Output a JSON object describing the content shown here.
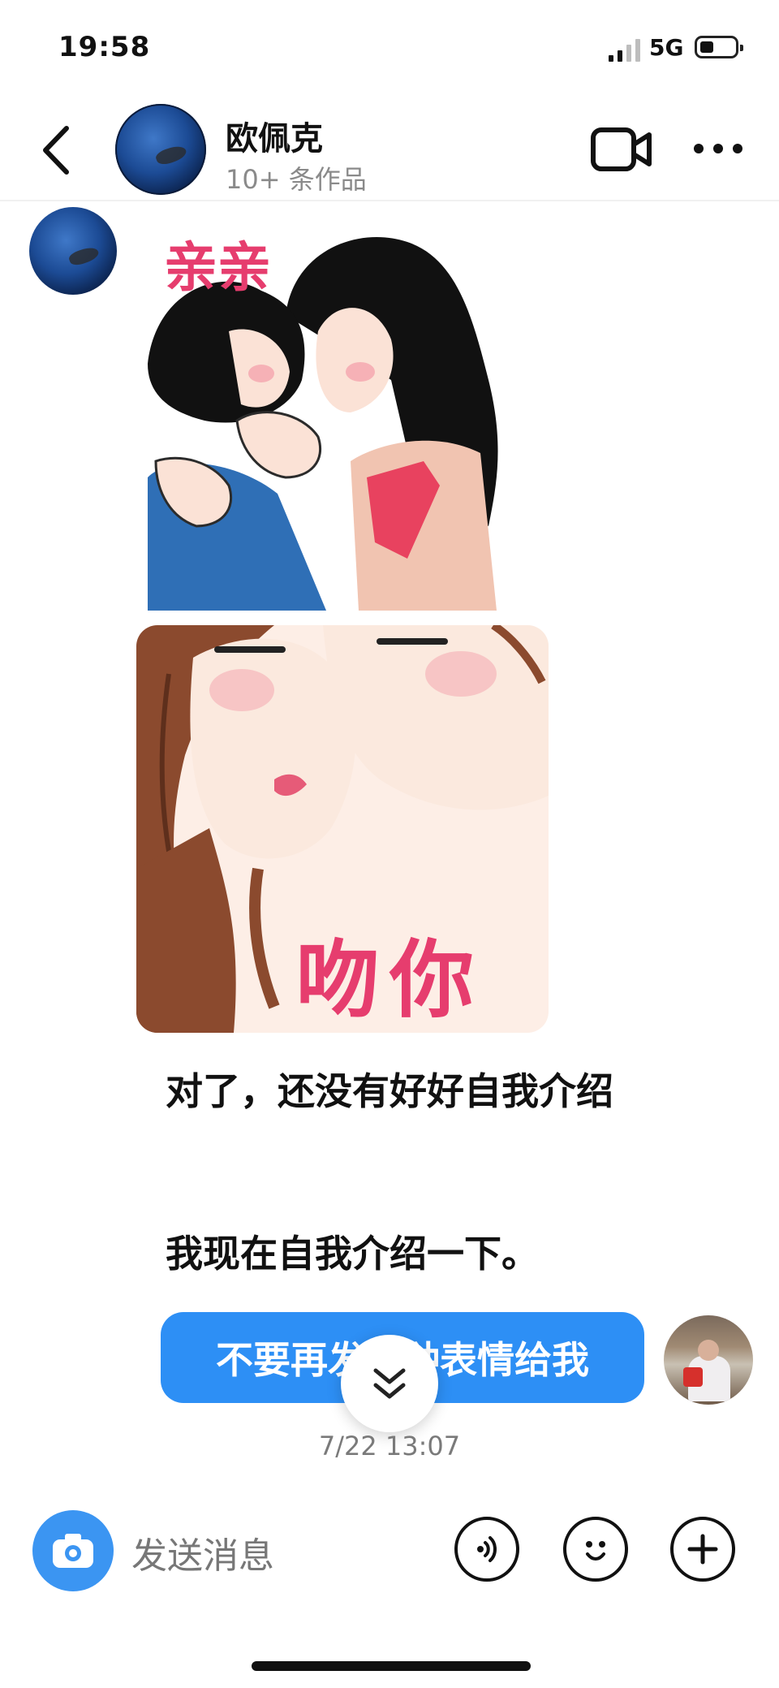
{
  "status_bar": {
    "time": "19:58",
    "network": "5G"
  },
  "header": {
    "name": "欧佩克",
    "subtitle": "10+ 条作品"
  },
  "messages": {
    "sticker1_caption": "亲亲",
    "sticker2_caption": "吻你",
    "text1": "对了，还没有好好自我介绍",
    "text2": "我现在自我介绍一下。",
    "sent1": "不要再发这种表情给我"
  },
  "timestamp": "7/22 13:07",
  "input": {
    "placeholder": "发送消息"
  },
  "colors": {
    "accent": "#2d8ff5",
    "sticker_text": "#e63d6e"
  }
}
